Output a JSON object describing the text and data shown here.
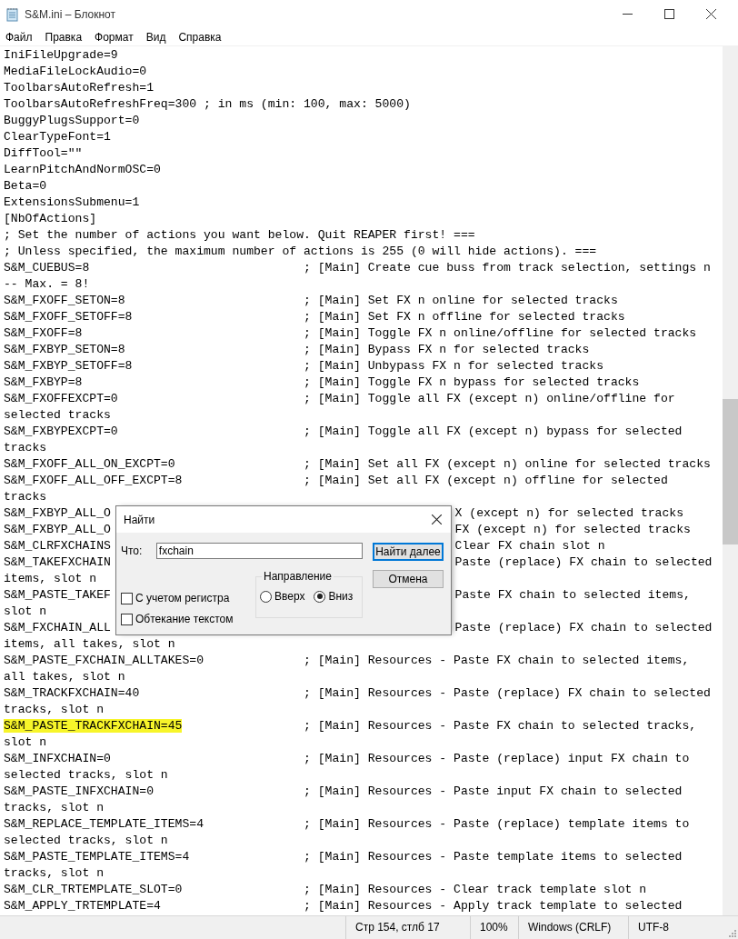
{
  "window": {
    "title": "S&M.ini – Блокнот"
  },
  "menu": [
    "Файл",
    "Правка",
    "Формат",
    "Вид",
    "Справка"
  ],
  "editor": {
    "lines": [
      {
        "kind": "plain",
        "text": "IniFileUpgrade=9",
        "highlighted": false
      },
      {
        "kind": "plain",
        "text": "MediaFileLockAudio=0",
        "highlighted": false
      },
      {
        "kind": "plain",
        "text": "ToolbarsAutoRefresh=1",
        "highlighted": false
      },
      {
        "kind": "plain",
        "text": "ToolbarsAutoRefreshFreq=300 ; in ms (min: 100, max: 5000)",
        "highlighted": false
      },
      {
        "kind": "plain",
        "text": "BuggyPlugsSupport=0",
        "highlighted": false
      },
      {
        "kind": "plain",
        "text": "ClearTypeFont=1",
        "highlighted": false
      },
      {
        "kind": "plain",
        "text": "DiffTool=\"\"",
        "highlighted": false
      },
      {
        "kind": "plain",
        "text": "LearnPitchAndNormOSC=0",
        "highlighted": false
      },
      {
        "kind": "plain",
        "text": "Beta=0",
        "highlighted": false
      },
      {
        "kind": "plain",
        "text": "ExtensionsSubmenu=1",
        "highlighted": false
      },
      {
        "kind": "plain",
        "text": "[NbOfActions]",
        "highlighted": false
      },
      {
        "kind": "plain",
        "text": "; Set the number of actions you want below. Quit REAPER first! ===",
        "highlighted": false
      },
      {
        "kind": "plain",
        "text": "; Unless specified, the maximum number of actions is 255 (0 will hide actions). ===",
        "highlighted": false
      },
      {
        "kind": "setting",
        "setting": "S&M_CUEBUS=8",
        "comment": "; [Main] Create cue buss from track selection, settings n",
        "highlighted": false
      },
      {
        "kind": "plain",
        "text": "-- Max. = 8!",
        "highlighted": false
      },
      {
        "kind": "setting",
        "setting": "S&M_FXOFF_SETON=8",
        "comment": "; [Main] Set FX n online for selected tracks",
        "highlighted": false
      },
      {
        "kind": "setting",
        "setting": "S&M_FXOFF_SETOFF=8",
        "comment": "; [Main] Set FX n offline for selected tracks",
        "highlighted": false
      },
      {
        "kind": "setting",
        "setting": "S&M_FXOFF=8",
        "comment": "; [Main] Toggle FX n online/offline for selected tracks",
        "highlighted": false
      },
      {
        "kind": "setting",
        "setting": "S&M_FXBYP_SETON=8",
        "comment": "; [Main] Bypass FX n for selected tracks",
        "highlighted": false
      },
      {
        "kind": "setting",
        "setting": "S&M_FXBYP_SETOFF=8",
        "comment": "; [Main] Unbypass FX n for selected tracks",
        "highlighted": false
      },
      {
        "kind": "setting",
        "setting": "S&M_FXBYP=8",
        "comment": "; [Main] Toggle FX n bypass for selected tracks",
        "highlighted": false
      },
      {
        "kind": "setting",
        "setting": "S&M_FXOFFEXCPT=0",
        "comment": "; [Main] Toggle all FX (except n) online/offline for",
        "highlighted": false
      },
      {
        "kind": "plain",
        "text": "selected tracks",
        "highlighted": false
      },
      {
        "kind": "setting",
        "setting": "S&M_FXBYPEXCPT=0",
        "comment": "; [Main] Toggle all FX (except n) bypass for selected",
        "highlighted": false
      },
      {
        "kind": "plain",
        "text": "tracks",
        "highlighted": false
      },
      {
        "kind": "setting",
        "setting": "S&M_FXOFF_ALL_ON_EXCPT=0",
        "comment": "; [Main] Set all FX (except n) online for selected tracks",
        "highlighted": false
      },
      {
        "kind": "setting",
        "setting": "S&M_FXOFF_ALL_OFF_EXCPT=8",
        "comment": "; [Main] Set all FX (except n) offline for selected",
        "highlighted": false
      },
      {
        "kind": "plain",
        "text": "tracks",
        "highlighted": false
      },
      {
        "kind": "covered",
        "setting": "S&M_FXBYP_ALL_O",
        "tail": "X (except n) for selected tracks",
        "highlighted": false
      },
      {
        "kind": "covered",
        "setting": "S&M_FXBYP_ALL_O",
        "tail": "FX (except n) for selected tracks",
        "highlighted": false
      },
      {
        "kind": "covered",
        "setting": "S&M_CLRFXCHAINS",
        "tail": "Clear FX chain slot n",
        "highlighted": false
      },
      {
        "kind": "covered",
        "setting": "S&M_TAKEFXCHAIN",
        "tail": "Paste (replace) FX chain to selected",
        "highlighted": false
      },
      {
        "kind": "plain",
        "text": "items, slot n",
        "highlighted": false
      },
      {
        "kind": "covered",
        "setting": "S&M_PASTE_TAKEF",
        "tail": "Paste FX chain to selected items,",
        "highlighted": false
      },
      {
        "kind": "plain",
        "text": "slot n",
        "highlighted": false
      },
      {
        "kind": "covered",
        "setting": "S&M_FXCHAIN_ALL",
        "tail": "Paste (replace) FX chain to selected",
        "highlighted": false
      },
      {
        "kind": "plain",
        "text": "items, all takes, slot n",
        "highlighted": false
      },
      {
        "kind": "setting",
        "setting": "S&M_PASTE_FXCHAIN_ALLTAKES=0",
        "comment": "; [Main] Resources - Paste FX chain to selected items,",
        "highlighted": false
      },
      {
        "kind": "plain",
        "text": "all takes, slot n",
        "highlighted": false
      },
      {
        "kind": "setting",
        "setting": "S&M_TRACKFXCHAIN=40",
        "comment": "; [Main] Resources - Paste (replace) FX chain to selected",
        "highlighted": false
      },
      {
        "kind": "plain",
        "text": "tracks, slot n",
        "highlighted": false
      },
      {
        "kind": "setting",
        "setting": "S&M_PASTE_TRACKFXCHAIN=45",
        "comment": "; [Main] Resources - Paste FX chain to selected tracks,",
        "highlighted": true
      },
      {
        "kind": "plain",
        "text": "slot n",
        "highlighted": false
      },
      {
        "kind": "setting",
        "setting": "S&M_INFXCHAIN=0",
        "comment": "; [Main] Resources - Paste (replace) input FX chain to",
        "highlighted": false
      },
      {
        "kind": "plain",
        "text": "selected tracks, slot n",
        "highlighted": false
      },
      {
        "kind": "setting",
        "setting": "S&M_PASTE_INFXCHAIN=0",
        "comment": "; [Main] Resources - Paste input FX chain to selected",
        "highlighted": false
      },
      {
        "kind": "plain",
        "text": "tracks, slot n",
        "highlighted": false
      },
      {
        "kind": "setting",
        "setting": "S&M_REPLACE_TEMPLATE_ITEMS=4",
        "comment": "; [Main] Resources - Paste (replace) template items to",
        "highlighted": false
      },
      {
        "kind": "plain",
        "text": "selected tracks, slot n",
        "highlighted": false
      },
      {
        "kind": "setting",
        "setting": "S&M_PASTE_TEMPLATE_ITEMS=4",
        "comment": "; [Main] Resources - Paste template items to selected",
        "highlighted": false
      },
      {
        "kind": "plain",
        "text": "tracks, slot n",
        "highlighted": false
      },
      {
        "kind": "setting",
        "setting": "S&M_CLR_TRTEMPLATE_SLOT=0",
        "comment": "; [Main] Resources - Clear track template slot n",
        "highlighted": false
      },
      {
        "kind": "setting",
        "setting": "S&M_APPLY_TRTEMPLATE=4",
        "comment": "; [Main] Resources - Apply track template to selected",
        "highlighted": false
      }
    ]
  },
  "find_dialog": {
    "title": "Найти",
    "what_label": "Что:",
    "what_value": "fxchain",
    "buttons": [
      {
        "label": "Найти далее",
        "default": true
      },
      {
        "label": "Отмена",
        "default": false
      }
    ],
    "direction": {
      "label": "Направление",
      "options": [
        {
          "label": "Вверх",
          "selected": false
        },
        {
          "label": "Вниз",
          "selected": true
        }
      ]
    },
    "checkboxes": [
      {
        "label": "С учетом регистра",
        "checked": false
      },
      {
        "label": "Обтекание текстом",
        "checked": false
      }
    ]
  },
  "status_bar": [
    "Стр 154, стлб 17",
    "100%",
    "Windows (CRLF)",
    "UTF-8"
  ]
}
